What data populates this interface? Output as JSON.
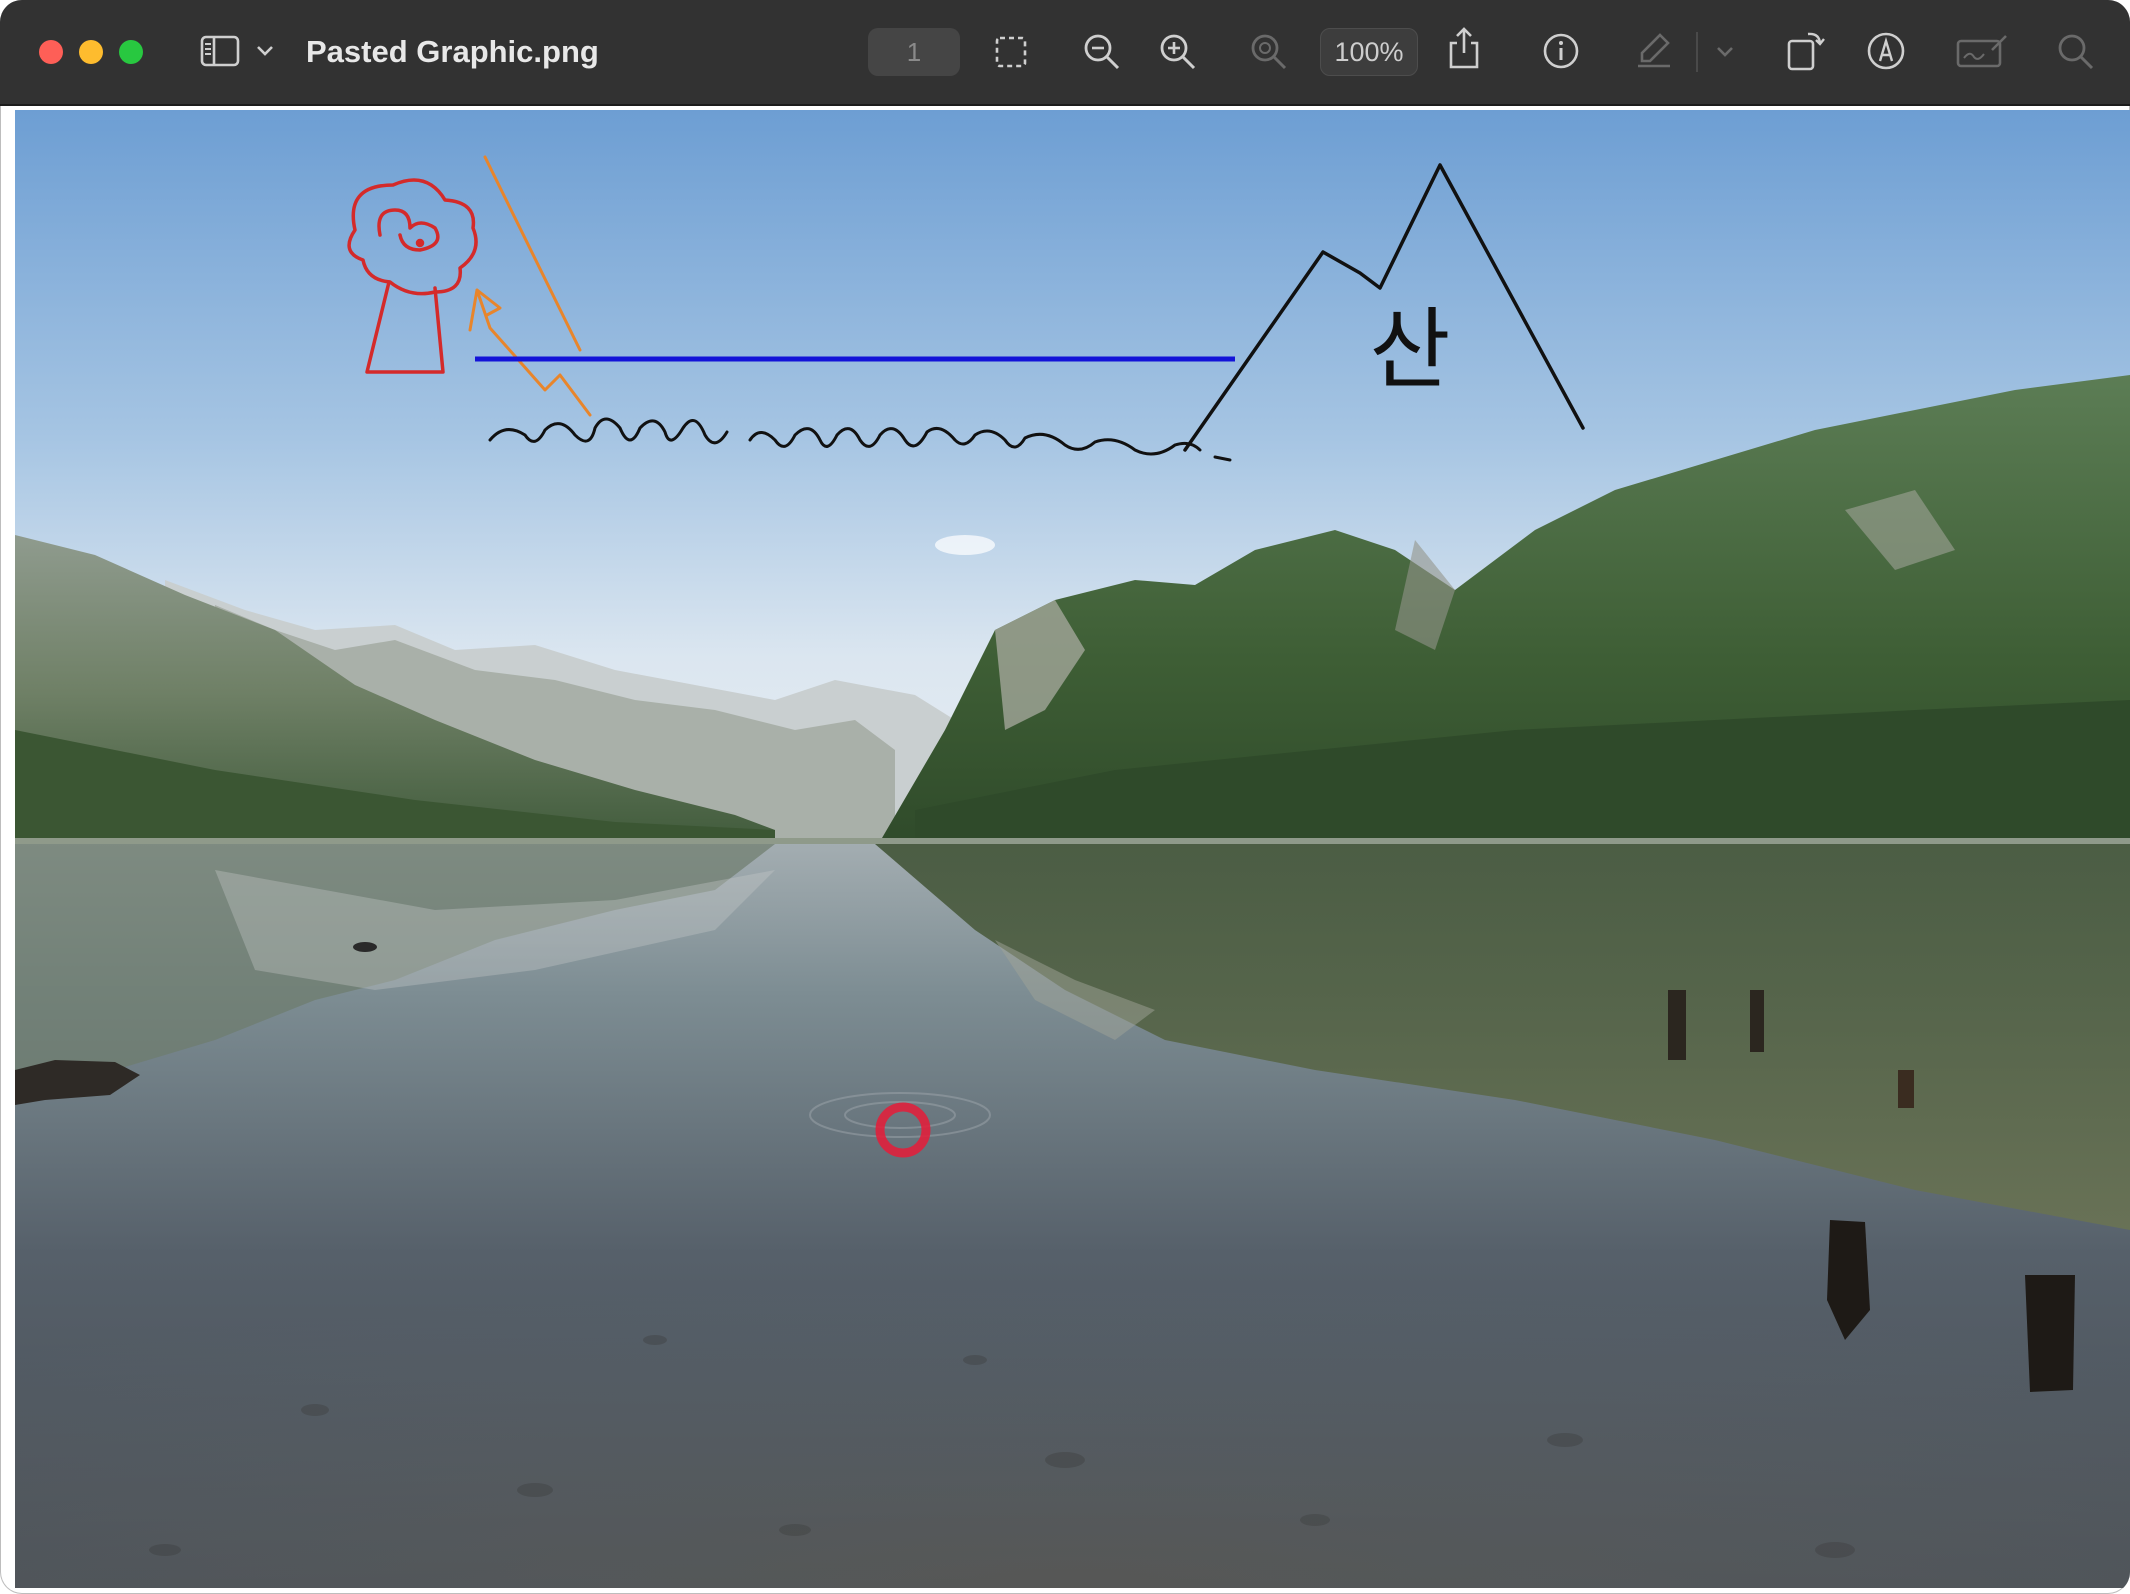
{
  "window": {
    "title": "Pasted Graphic.png",
    "page_number": "1",
    "zoom_level": "100%"
  },
  "toolbar": {
    "icons": [
      "sidebar-icon",
      "chevron-down-icon",
      "selection-icon",
      "zoom-out-icon",
      "zoom-in-icon",
      "actual-size-icon",
      "share-icon",
      "info-icon",
      "highlight-pen-icon",
      "chevron-down-icon",
      "rotate-icon",
      "markup-icon",
      "signature-icon",
      "search-icon"
    ]
  },
  "image": {
    "handwritten_text": "산",
    "colors": {
      "stick_figure": "#d42a2a",
      "arrow": "#e8852b",
      "horizon_line": "#1313d8",
      "ink": "#111111",
      "click_ring": "#e0203c",
      "titlebar": "#323232"
    }
  }
}
